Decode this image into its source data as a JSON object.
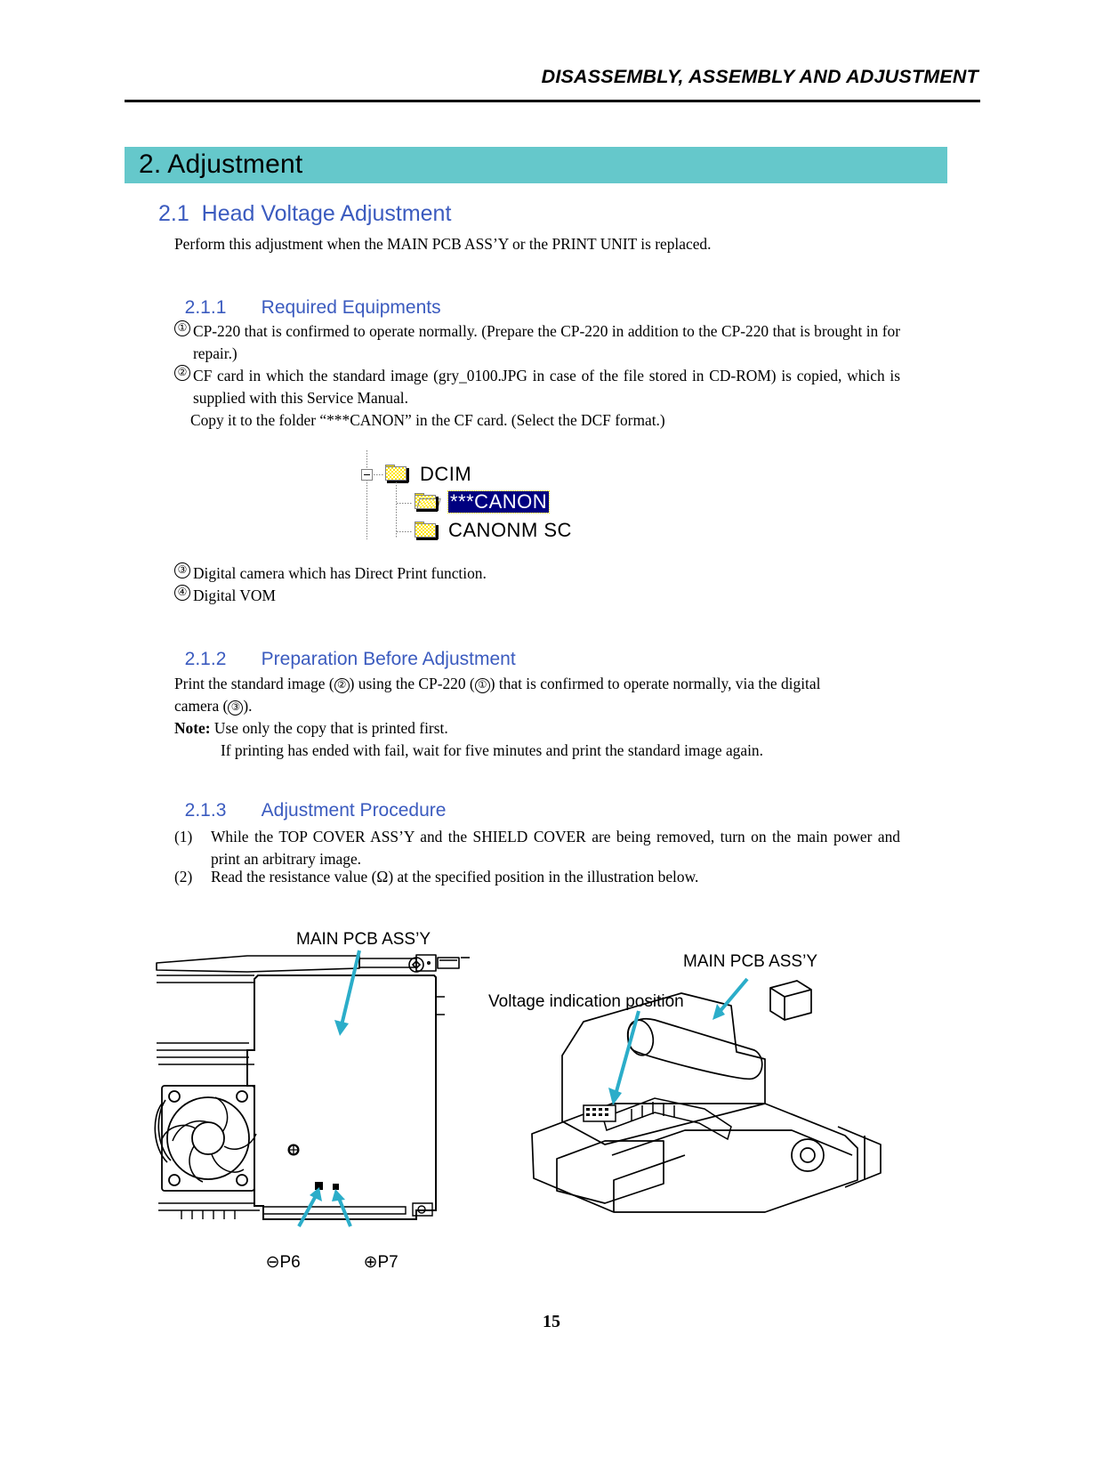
{
  "header": {
    "running_title": "DISASSEMBLY, ASSEMBLY AND ADJUSTMENT"
  },
  "chapter": {
    "title": "2. Adjustment",
    "banner_color": "#65c8cb"
  },
  "sections": {
    "s21_title": "2.1  Head Voltage Adjustment",
    "s21_intro": "Perform this adjustment when the MAIN PCB ASS’Y or the PRINT UNIT is replaced.",
    "s211_num": "2.1.1",
    "s211_title": "Required Equipments",
    "s212_num": "2.1.2",
    "s212_title": "Preparation Before Adjustment",
    "s213_num": "2.1.3",
    "s213_title": "Adjustment Procedure"
  },
  "equipment": {
    "item1_marker": "①",
    "item1_text": "CP-220 that is confirmed to operate normally. (Prepare the CP-220 in addition to the CP-220 that is brought in for repair.)",
    "item2_marker": "②",
    "item2_text": "CF card in which the standard image (gry_0100.JPG in case of the file stored in CD-ROM) is copied, which is supplied with this Service Manual.",
    "item2_text_line3": "Copy it to the folder “***CANON” in the CF card. (Select the DCF format.)",
    "item3_marker": "③",
    "item3_text": "Digital camera which has Direct Print function.",
    "item4_marker": "④",
    "item4_text": "Digital VOM"
  },
  "tree": {
    "root_label": "DCIM",
    "child1_label": "***CANON",
    "child1_selected": true,
    "child2_label": "CANONM SC",
    "expander_state": "collapse",
    "selection_bg": "#000080",
    "folder_color": "#ffe400"
  },
  "preparation": {
    "line1_a": "Print the standard image (",
    "line1_m1": "②",
    "line1_b": ") using the CP-220 (",
    "line1_m2": "①",
    "line1_c": ") that is confirmed to operate normally, via the digital",
    "line2_a": "camera (",
    "line2_m3": "③",
    "line2_b": ").",
    "note_label": "Note:",
    "note_line1": "Use only the copy that is printed first.",
    "note_line2": "If printing has ended with fail, wait for five minutes and print the standard image again."
  },
  "procedure": {
    "step1_num": "(1)",
    "step1_text": "While the TOP COVER ASS’Y and the SHIELD COVER are being removed, turn on the main power and print an arbitrary image.",
    "step2_num": "(2)",
    "step2_text_a": "Read the resistance value (",
    "step2_omega": "Ω",
    "step2_text_b": ") at the specified position in the illustration below."
  },
  "figures": {
    "left_label_main_pcb": "MAIN PCB ASS’Y",
    "left_label_p6": "P6",
    "left_label_p7": "P7",
    "left_marker_p6": "⊖",
    "left_marker_p7": "⊕",
    "right_label_main_pcb": "MAIN PCB ASS’Y",
    "right_label_voltage": "Voltage indication position",
    "callout_color": "#2badc9"
  },
  "footer": {
    "page_number": "15"
  }
}
